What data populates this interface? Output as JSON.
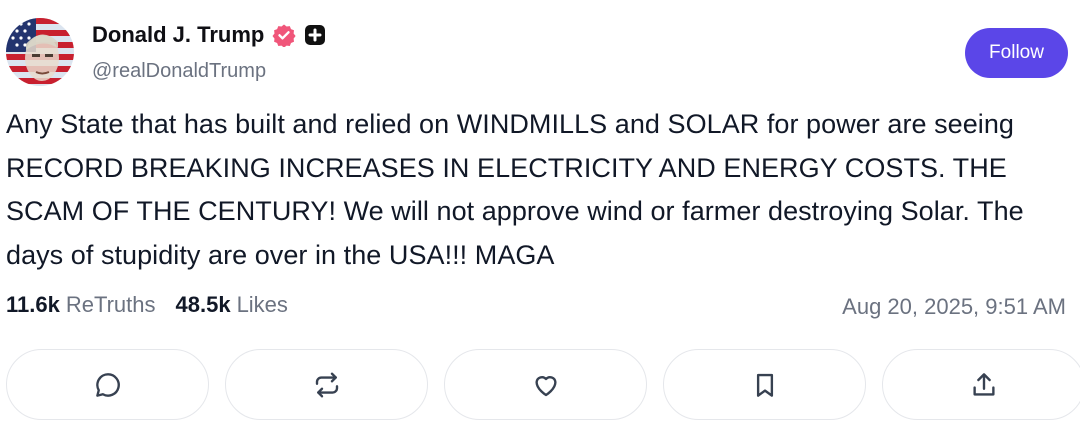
{
  "user": {
    "display_name": "Donald J. Trump",
    "handle": "@realDonaldTrump",
    "verified_icon": "verified-badge-icon",
    "extra_badge_icon": "plus-badge-icon"
  },
  "follow_button": {
    "label": "Follow",
    "color": "#5b46e8"
  },
  "post": {
    "text": "Any State that has built and relied on WINDMILLS and SOLAR for power are seeing RECORD BREAKING INCREASES IN ELECTRICITY AND ENERGY COSTS. THE SCAM OF THE CENTURY! We will not approve wind or farmer destroying Solar. The days of stupidity are over in the USA!!! MAGA"
  },
  "stats": {
    "retruths_count": "11.6k",
    "retruths_label": "ReTruths",
    "likes_count": "48.5k",
    "likes_label": "Likes",
    "timestamp": "Aug 20, 2025, 9:51 AM"
  },
  "actions": [
    {
      "icon": "reply-icon"
    },
    {
      "icon": "retruth-icon"
    },
    {
      "icon": "like-heart-icon"
    },
    {
      "icon": "bookmark-icon"
    },
    {
      "icon": "share-icon"
    }
  ],
  "colors": {
    "accent": "#5b46e8",
    "verified_badge": "#f0567a",
    "text": "#111827",
    "muted": "#6b7280",
    "border": "#e5e7eb"
  }
}
